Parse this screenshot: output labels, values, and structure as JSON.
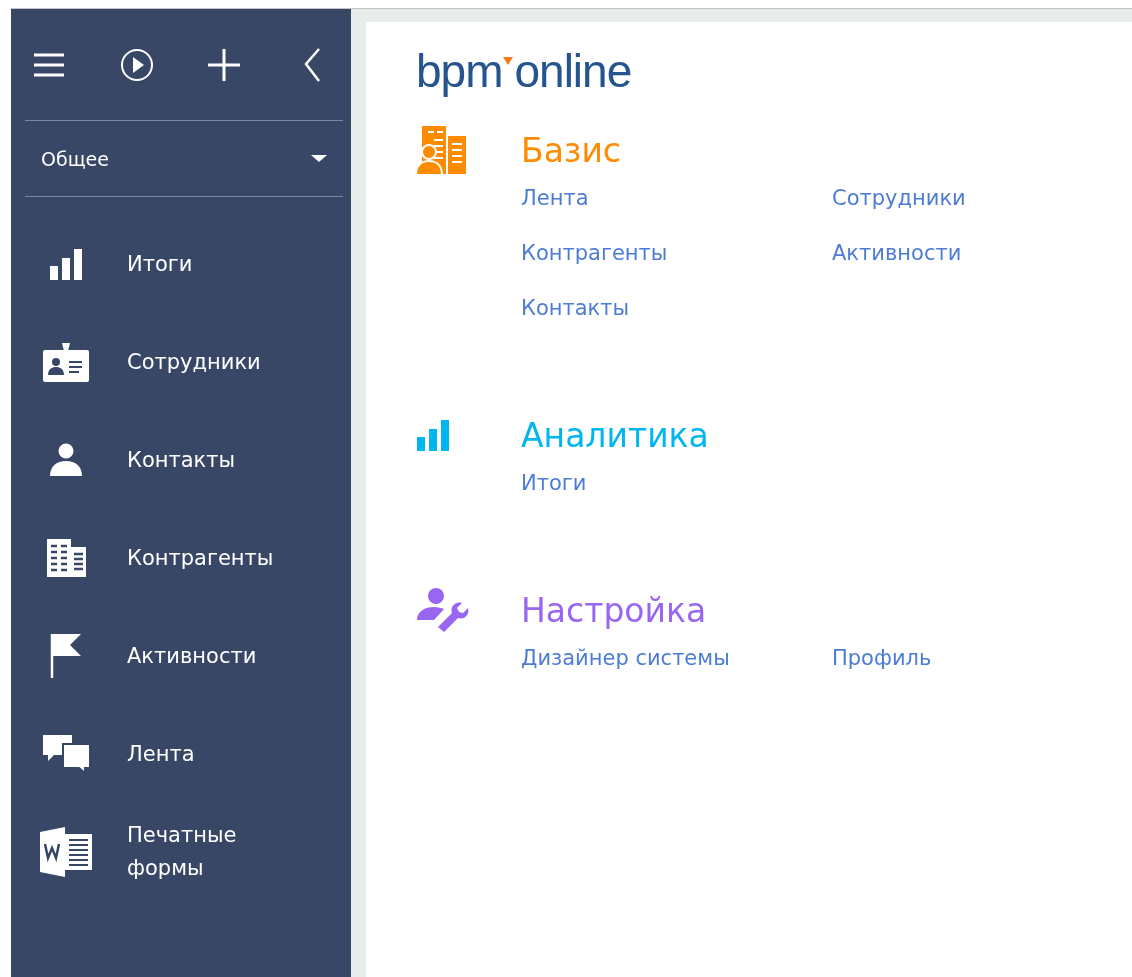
{
  "sidebar": {
    "header_buttons": [
      {
        "kind": "menu"
      },
      {
        "kind": "play"
      },
      {
        "kind": "add"
      },
      {
        "kind": "back"
      }
    ],
    "workplace": {
      "label": "Общее"
    },
    "items": [
      {
        "label": "Итоги",
        "kind": "chart"
      },
      {
        "label": "Сотрудники",
        "kind": "badge"
      },
      {
        "label": "Контакты",
        "kind": "person"
      },
      {
        "label": "Контрагенты",
        "kind": "building"
      },
      {
        "label": "Активности",
        "kind": "flag"
      },
      {
        "label": "Лента",
        "kind": "chat"
      },
      {
        "label": "Печатные формы",
        "kind": "document"
      }
    ]
  },
  "logo": {
    "left": "bpm",
    "right": "online"
  },
  "sections": [
    {
      "title": "Базис",
      "kind": "building-person",
      "color": "#ff8c00",
      "links": [
        "Лента",
        "Сотрудники",
        "Контрагенты",
        "Активности",
        "Контакты"
      ]
    },
    {
      "title": "Аналитика",
      "kind": "chart",
      "color": "#00b6f0",
      "links": [
        "Итоги"
      ]
    },
    {
      "title": "Настройка",
      "kind": "person-wrench",
      "color": "#9966f2",
      "links": [
        "Дизайнер системы",
        "Профиль"
      ]
    }
  ]
}
